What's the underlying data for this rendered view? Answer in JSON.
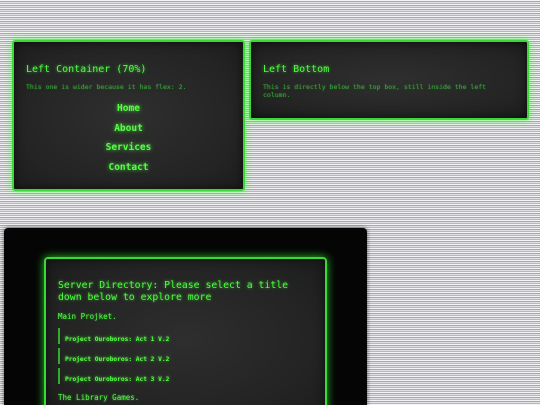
{
  "left_container": {
    "title": "Left Container (70%)",
    "note": "This one is wider because it has flex: 2.",
    "nav": [
      {
        "label": "Home"
      },
      {
        "label": "About"
      },
      {
        "label": "Services"
      },
      {
        "label": "Contact"
      }
    ]
  },
  "left_bottom": {
    "title": "Left Bottom",
    "note": "This is directly below the top box, still inside the left column."
  },
  "server": {
    "title": "Server Directory: Please select a title down below to explore more",
    "main_label": "Main Projket.",
    "projects": [
      {
        "label": "Project Ouroboros: Act 1 V.2"
      },
      {
        "label": "Project Ouroboros: Act 2 V.2"
      },
      {
        "label": "Project Ouroboros: Act 3 V.2"
      }
    ],
    "library_label": "The Library Games."
  },
  "colors": {
    "accent": "#39d936",
    "text": "#4cff3f",
    "panel_bg": "#232423"
  }
}
